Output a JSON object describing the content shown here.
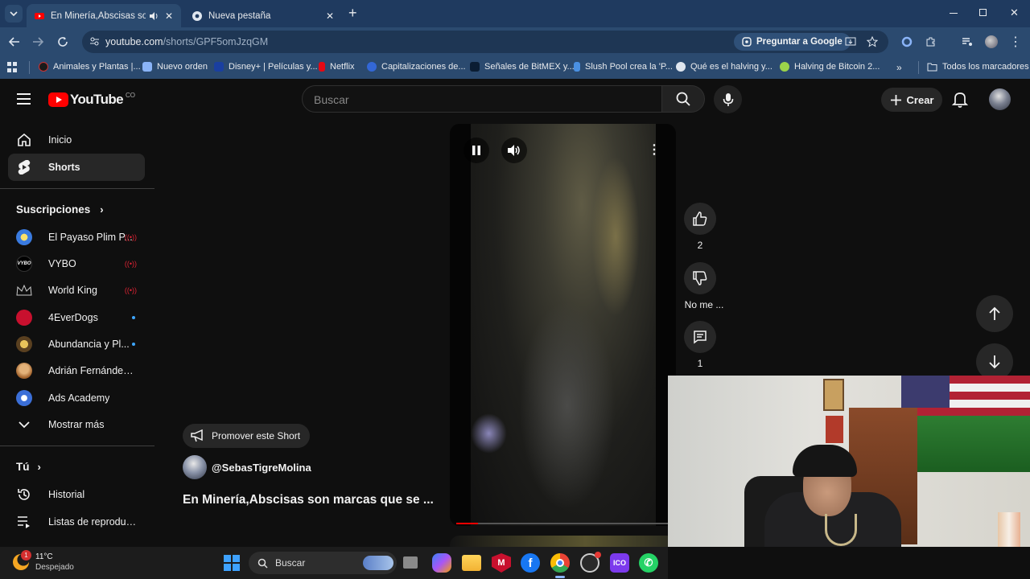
{
  "browser": {
    "tabs": [
      {
        "title": "En Minería,Abscisas son ma",
        "active": true
      },
      {
        "title": "Nueva pestaña",
        "active": false
      }
    ],
    "url_host": "youtube.com",
    "url_path": "/shorts/GPF5omJzqGM",
    "ask_google": "Preguntar a Google",
    "bookmarks": [
      "Animales y Plantas |...",
      "Nuevo orden",
      "Disney+ | Películas y...",
      "Netflix",
      "Capitalizaciones de...",
      "Señales de BitMEX y...",
      "Slush Pool crea la 'P...",
      "Qué es el halving y...",
      "Halving de Bitcoin 2..."
    ],
    "all_bookmarks": "Todos los marcadores"
  },
  "youtube": {
    "logo": "YouTube",
    "country": "CO",
    "search_placeholder": "Buscar",
    "create_label": "Crear"
  },
  "sidebar": {
    "home": "Inicio",
    "shorts": "Shorts",
    "subscriptions_header": "Suscripciones",
    "subscriptions": [
      {
        "name": "El Payaso Plim P...",
        "badge": "live"
      },
      {
        "name": "VYBO",
        "badge": "live"
      },
      {
        "name": "World King",
        "badge": "live"
      },
      {
        "name": "4EverDogs",
        "badge": "dot"
      },
      {
        "name": "Abundancia y Pl...",
        "badge": "dot"
      },
      {
        "name": "Adrián Fernández - ...",
        "badge": ""
      },
      {
        "name": "Ads Academy",
        "badge": ""
      }
    ],
    "show_more": "Mostrar más",
    "you_header": "Tú",
    "history": "Historial",
    "playlists": "Listas de reproducc..."
  },
  "short": {
    "promote": "Promover este Short",
    "channel": "@SebasTigreMolina",
    "title": "En Minería,Abscisas son marcas que se ...",
    "likes": "2",
    "dislike_label": "No me ...",
    "comments": "1",
    "progress": 0.1
  },
  "taskbar": {
    "temperature": "11°C",
    "weather": "Despejado",
    "search": "Buscar",
    "weather_badge": "1"
  }
}
